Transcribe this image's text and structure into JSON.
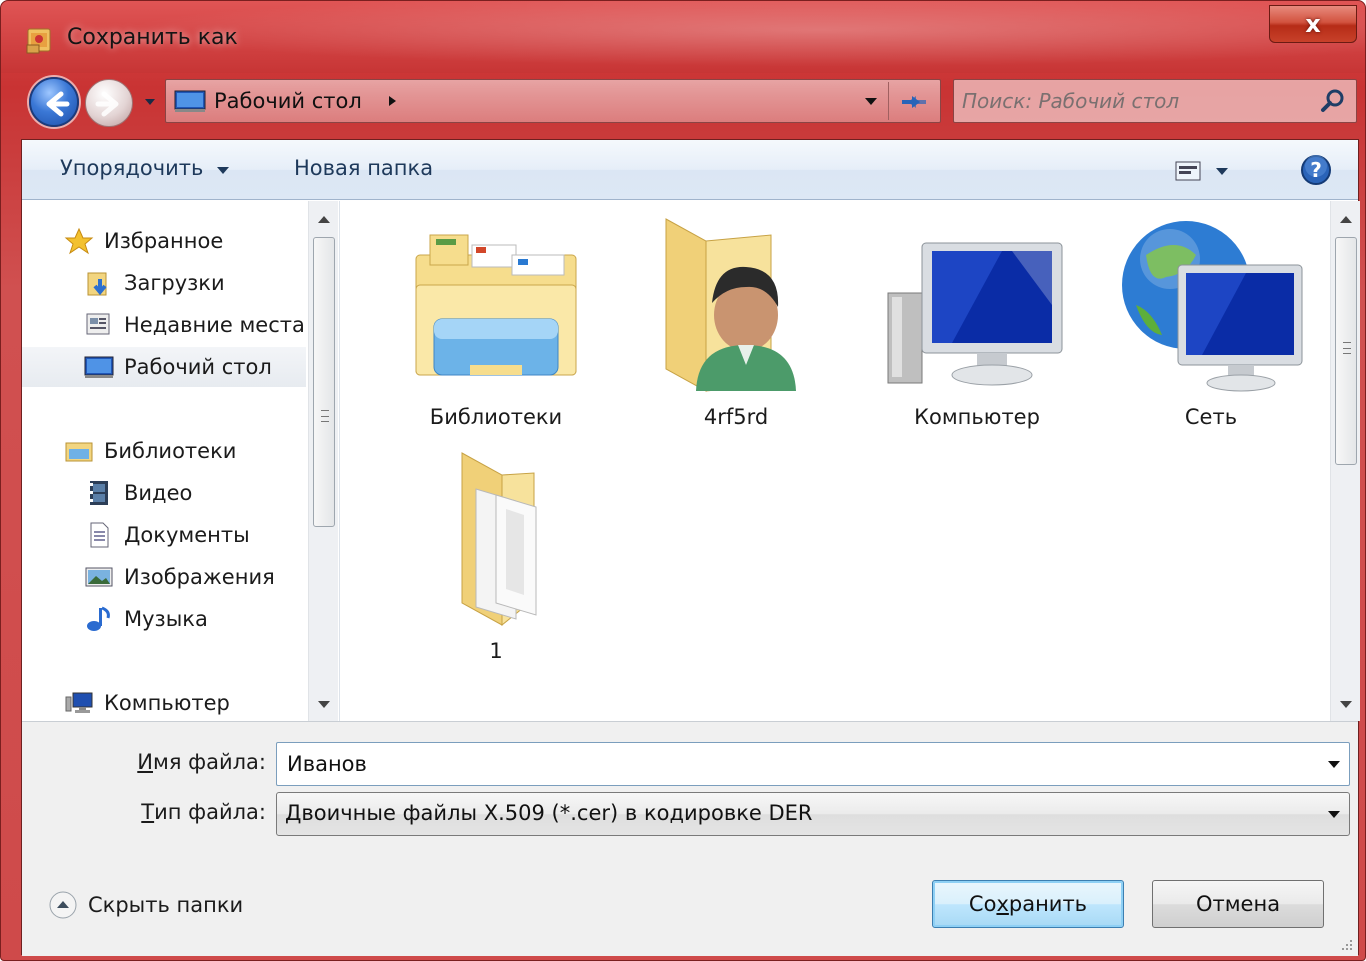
{
  "window": {
    "title": "Сохранить как",
    "close_label": "x"
  },
  "address": {
    "location": "Рабочий стол"
  },
  "search": {
    "placeholder": "Поиск: Рабочий стол"
  },
  "toolbar": {
    "organize_label": "Упорядочить",
    "new_folder_label": "Новая папка"
  },
  "nav": {
    "favorites": "Избранное",
    "downloads": "Загрузки",
    "recent": "Недавние места",
    "desktop": "Рабочий стол",
    "libraries": "Библиотеки",
    "video": "Видео",
    "documents": "Документы",
    "images": "Изображения",
    "music": "Музыка",
    "computer": "Компьютер"
  },
  "files": [
    {
      "label": "Библиотеки",
      "icon": "libraries-icon"
    },
    {
      "label": "4rf5rd",
      "icon": "user-folder-icon"
    },
    {
      "label": "Компьютер",
      "icon": "computer-icon"
    },
    {
      "label": "Сеть",
      "icon": "network-icon"
    },
    {
      "label": "1",
      "icon": "folder-icon"
    }
  ],
  "form": {
    "filename_label_pre": "И",
    "filename_label_post": "мя файла:",
    "filename_value": "Иванов",
    "filetype_label_pre": "Т",
    "filetype_label_post": "ип файла:",
    "filetype_value": "Двоичные файлы X.509 (*.cer) в кодировке DER"
  },
  "footer": {
    "hide_folders_label": "Скрыть папки",
    "save_pre": "Со",
    "save_mid": "х",
    "save_post": "ранить",
    "cancel_label": "Отмена"
  },
  "colors": {
    "frame": "#c93333",
    "toolbar_text": "#1e395b",
    "save_button": "#bee6fd"
  }
}
